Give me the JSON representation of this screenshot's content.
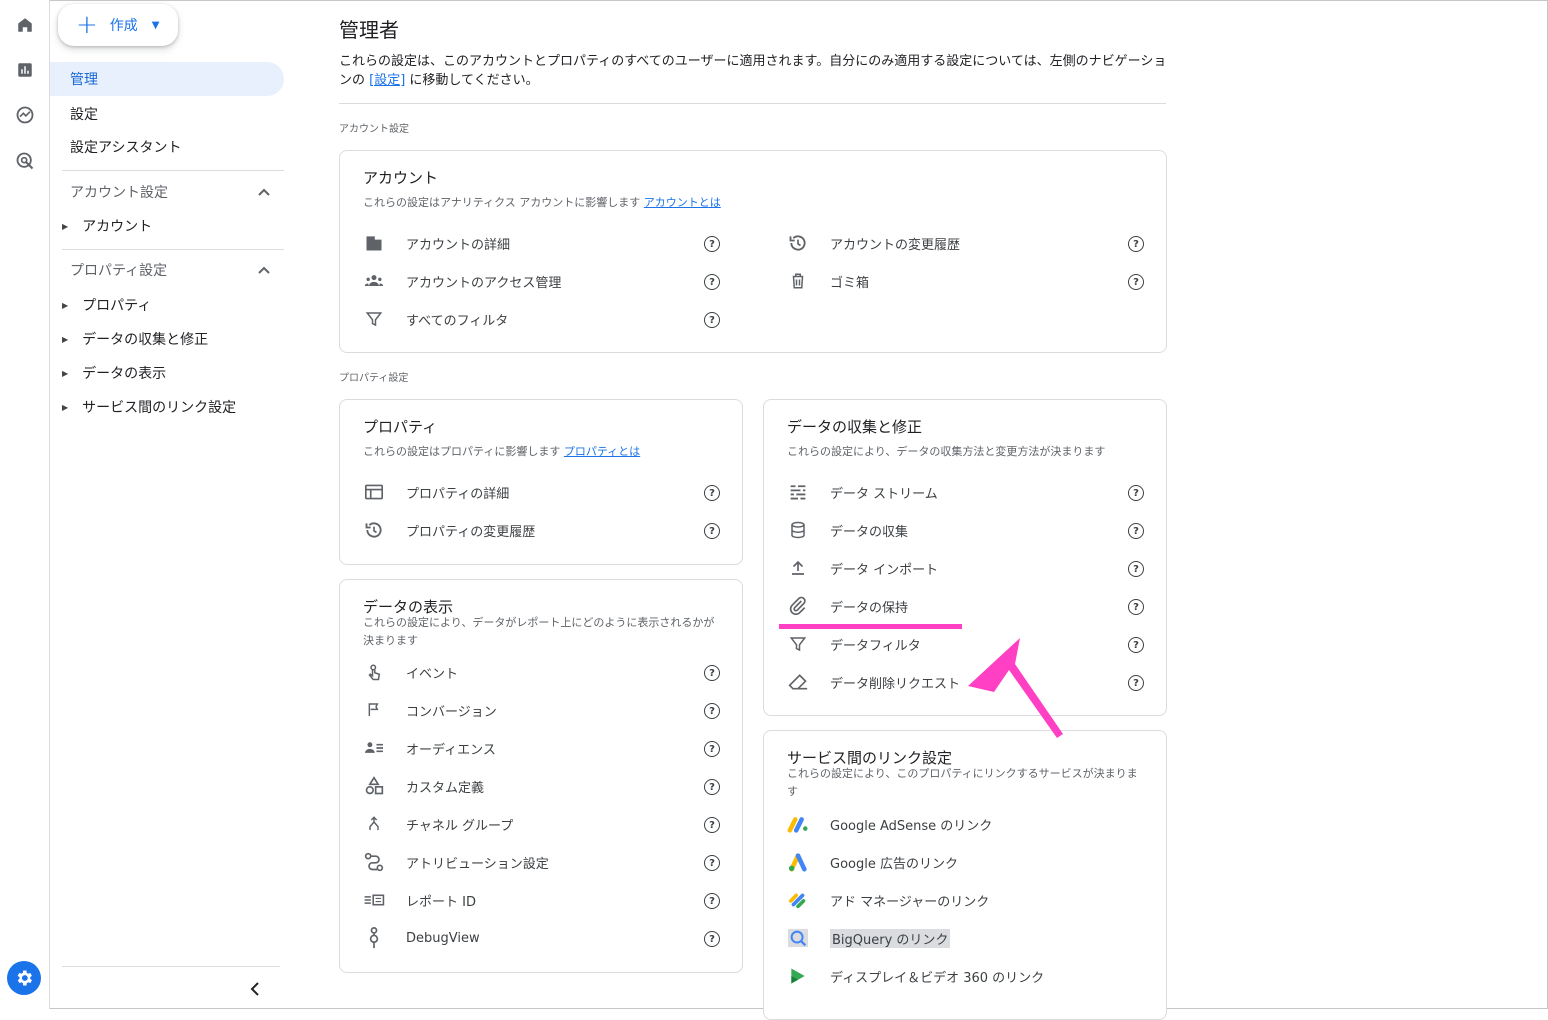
{
  "nav": {
    "create_label": "作成",
    "items": [
      "管理",
      "設定",
      "設定アシスタント"
    ],
    "account_section": "アカウント設定",
    "account_items": [
      "アカウント"
    ],
    "property_section": "プロパティ設定",
    "property_items": [
      "プロパティ",
      "データの収集と修正",
      "データの表示",
      "サービス間のリンク設定"
    ]
  },
  "main": {
    "title": "管理者",
    "intro_before": "これらの設定は、このアカウントとプロパティのすべてのユーザーに適用されます。自分にのみ適用する設定については、左側のナビゲーションの ",
    "intro_link": "[設定]",
    "intro_after": " に移動してください。",
    "account_section_label": "アカウント設定",
    "property_section_label": "プロパティ設定"
  },
  "account_card": {
    "title": "アカウント",
    "desc": "これらの設定はアナリティクス アカウントに影響します",
    "desc_link": "アカウントとは",
    "left": [
      {
        "label": "アカウントの詳細",
        "icon": "building-icon"
      },
      {
        "label": "アカウントのアクセス管理",
        "icon": "group-icon"
      },
      {
        "label": "すべてのフィルタ",
        "icon": "filter-icon"
      }
    ],
    "right": [
      {
        "label": "アカウントの変更履歴",
        "icon": "history-icon"
      },
      {
        "label": "ゴミ箱",
        "icon": "trash-icon"
      }
    ]
  },
  "property_card": {
    "title": "プロパティ",
    "desc": "これらの設定はプロパティに影響します",
    "desc_link": "プロパティとは",
    "items": [
      {
        "label": "プロパティの詳細",
        "icon": "web-icon"
      },
      {
        "label": "プロパティの変更履歴",
        "icon": "history-icon"
      }
    ]
  },
  "display_card": {
    "title": "データの表示",
    "desc": "これらの設定により、データがレポート上にどのように表示されるかが決まります",
    "items": [
      {
        "label": "イベント",
        "icon": "touch-icon"
      },
      {
        "label": "コンバージョン",
        "icon": "flag-icon"
      },
      {
        "label": "オーディエンス",
        "icon": "audience-icon"
      },
      {
        "label": "カスタム定義",
        "icon": "shapes-icon"
      },
      {
        "label": "チャネル グループ",
        "icon": "merge-icon"
      },
      {
        "label": "アトリビューション設定",
        "icon": "route-icon"
      },
      {
        "label": "レポート ID",
        "icon": "report-id-icon"
      },
      {
        "label": "DebugView",
        "icon": "debug-icon"
      }
    ]
  },
  "collection_card": {
    "title": "データの収集と修正",
    "desc": "これらの設定により、データの収集方法と変更方法が決まります",
    "items": [
      {
        "label": "データ ストリーム",
        "icon": "stream-icon"
      },
      {
        "label": "データの収集",
        "icon": "database-icon"
      },
      {
        "label": "データ インポート",
        "icon": "upload-icon"
      },
      {
        "label": "データの保持",
        "icon": "attach-icon"
      },
      {
        "label": "データフィルタ",
        "icon": "filter-icon"
      },
      {
        "label": "データ削除リクエスト",
        "icon": "eraser-icon"
      }
    ]
  },
  "links_card": {
    "title": "サービス間のリンク設定",
    "desc": "これらの設定により、このプロパティにリンクするサービスが決まります",
    "items": [
      {
        "label": "Google AdSense のリンク",
        "icon": "adsense-icon"
      },
      {
        "label": "Google 広告のリンク",
        "icon": "google-ads-icon"
      },
      {
        "label": "アド マネージャーのリンク",
        "icon": "ad-manager-icon"
      },
      {
        "label": "BigQuery のリンク",
        "icon": "bigquery-icon"
      },
      {
        "label": "ディスプレイ＆ビデオ 360 のリンク",
        "icon": "dv360-icon"
      }
    ]
  },
  "help_glyph": "?",
  "colors": {
    "accent": "#1a73e8",
    "annotation": "#ff3fc4"
  }
}
